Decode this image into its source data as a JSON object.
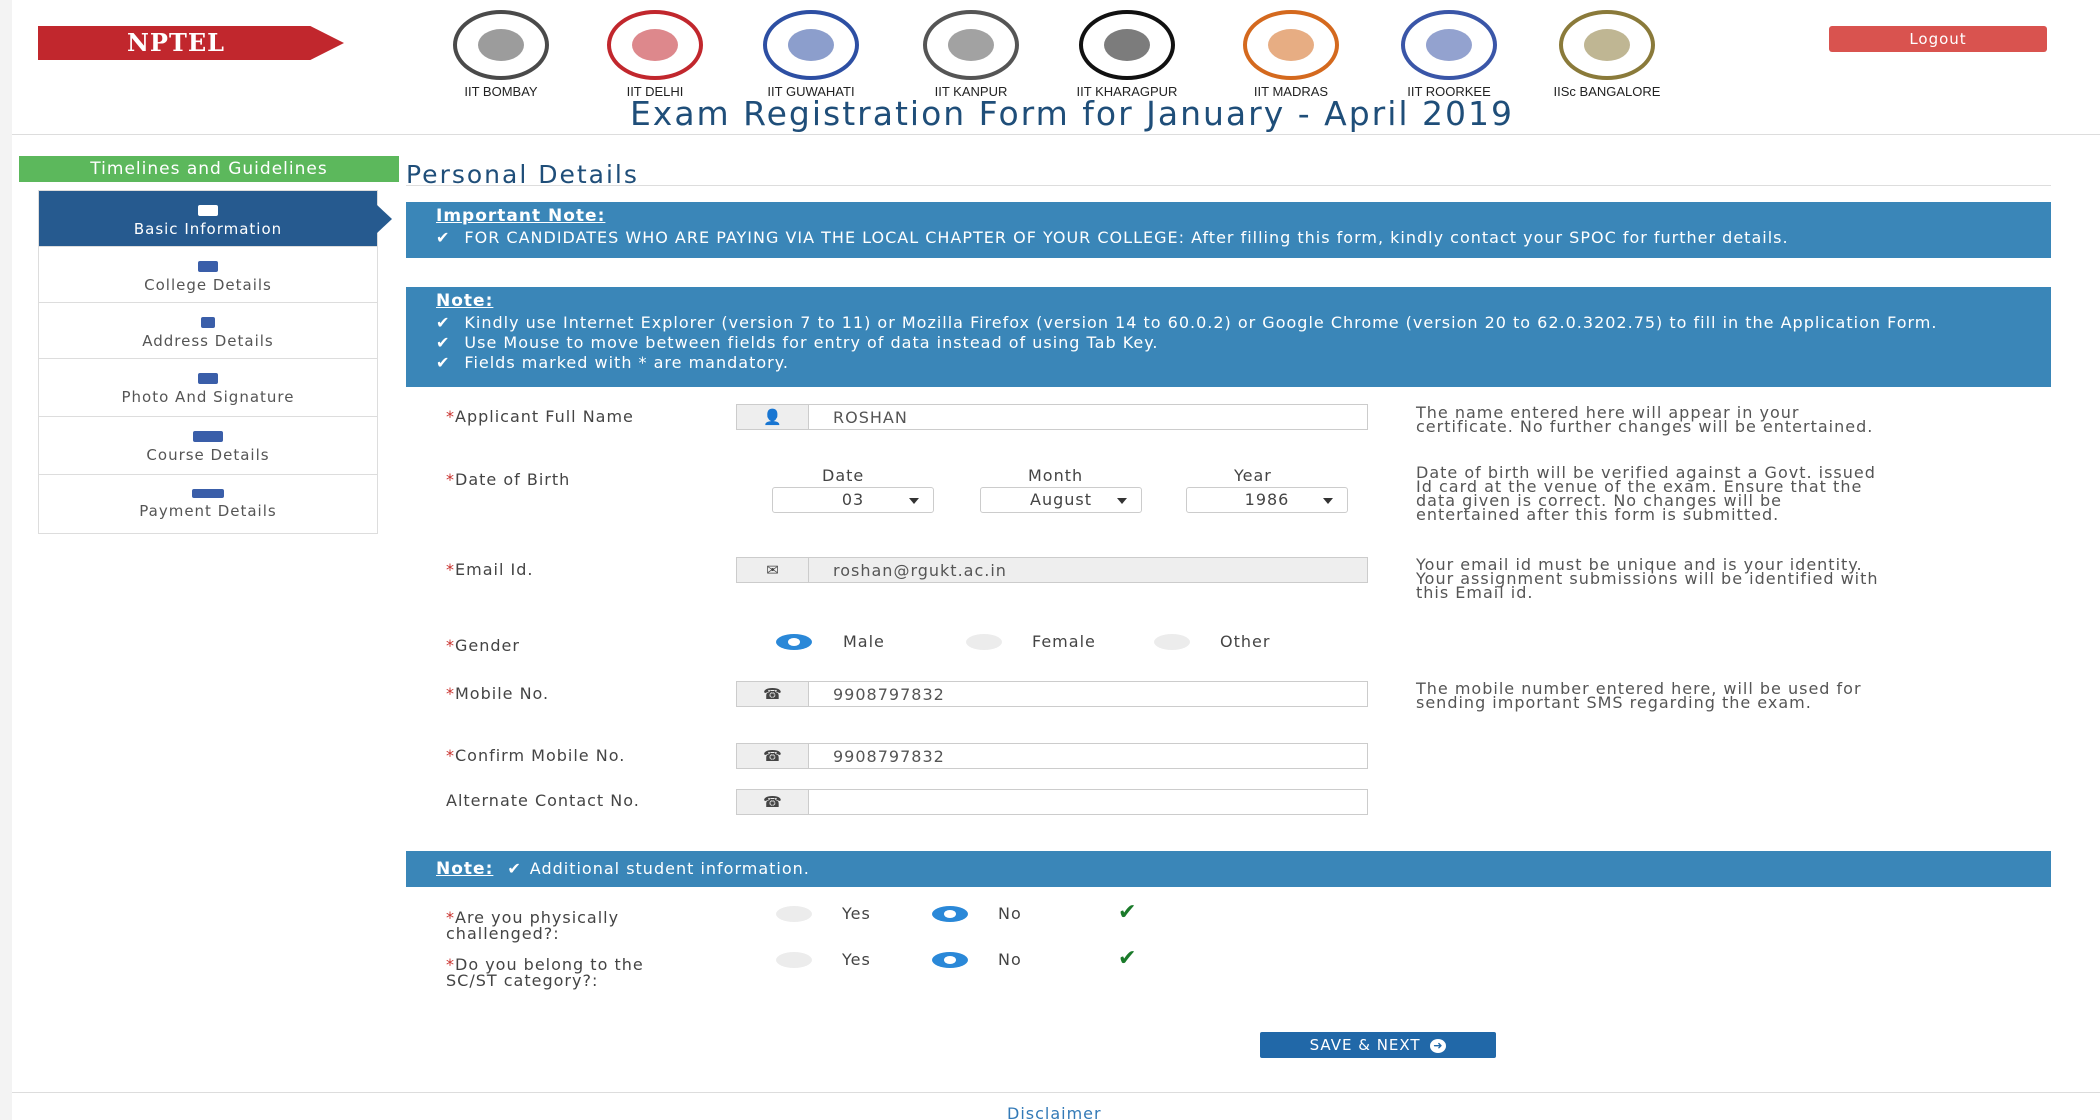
{
  "header": {
    "brand": "NPTEL",
    "logout_label": "Logout",
    "page_title": "Exam Registration Form for January - April 2019",
    "institutes": [
      {
        "name": "IIT BOMBAY",
        "color": "#4a4a4a"
      },
      {
        "name": "IIT DELHI",
        "color": "#c1272d"
      },
      {
        "name": "IIT GUWAHATI",
        "color": "#2d4fa3"
      },
      {
        "name": "IIT KANPUR",
        "color": "#555555"
      },
      {
        "name": "IIT KHARAGPUR",
        "color": "#111111"
      },
      {
        "name": "IIT MADRAS",
        "color": "#d4691e"
      },
      {
        "name": "IIT ROORKEE",
        "color": "#3a56a8"
      },
      {
        "name": "IISc BANGALORE",
        "color": "#8a7a3a"
      }
    ]
  },
  "sidebar": {
    "timelines_label": "Timelines and Guidelines",
    "items": [
      {
        "label": "Basic Information",
        "active": true
      },
      {
        "label": "College Details",
        "active": false
      },
      {
        "label": "Address Details",
        "active": false
      },
      {
        "label": "Photo And Signature",
        "active": false
      },
      {
        "label": "Course Details",
        "active": false
      },
      {
        "label": "Payment Details",
        "active": false
      }
    ]
  },
  "main": {
    "section_title": "Personal Details",
    "important_note": {
      "title": "Important Note:",
      "lines": [
        "FOR CANDIDATES WHO ARE PAYING VIA THE LOCAL CHAPTER OF YOUR COLLEGE: After filling this form, kindly contact your SPOC for further details."
      ]
    },
    "note": {
      "title": "Note:",
      "lines": [
        "Kindly use Internet Explorer (version 7 to 11) or Mozilla Firefox (version 14 to 60.0.2) or Google Chrome (version 20 to 62.0.3202.75) to fill in the Application Form.",
        "Use Mouse to move between fields for entry of data instead of using Tab Key.",
        "Fields marked with * are mandatory."
      ]
    },
    "full_name": {
      "label": "Applicant Full Name",
      "value": "ROSHAN",
      "help": "The name entered here will appear in your certificate. No further changes will be entertained."
    },
    "dob": {
      "label": "Date of Birth",
      "date_head": "Date",
      "month_head": "Month",
      "year_head": "Year",
      "date": "03",
      "month": "August",
      "year": "1986",
      "help": "Date of birth will be verified against a Govt. issued Id card at the venue of the exam. Ensure that the data given is correct. No changes will be entertained after this form is submitted."
    },
    "email": {
      "label": "Email Id.",
      "value": "roshan@rgukt.ac.in",
      "help": "Your email id must be unique and is your identity. Your assignment submissions will be identified with this Email id."
    },
    "gender": {
      "label": "Gender",
      "options": [
        "Male",
        "Female",
        "Other"
      ],
      "selected": "Male"
    },
    "mobile": {
      "label": "Mobile No.",
      "value": "9908797832",
      "help": "The mobile number entered here, will be used for sending important SMS regarding the exam."
    },
    "confirm_mobile": {
      "label": "Confirm Mobile No.",
      "value": "9908797832"
    },
    "alt_contact": {
      "label": "Alternate Contact No.",
      "value": ""
    },
    "additional_note": {
      "title": "Note:",
      "text": "Additional student information."
    },
    "physically_challenged": {
      "label": "Are you physically challenged?:",
      "yes": "Yes",
      "no": "No",
      "selected": "No"
    },
    "scst": {
      "label": "Do you belong to the SC/ST category?:",
      "yes": "Yes",
      "no": "No",
      "selected": "No"
    },
    "save_label": "SAVE & NEXT",
    "disclaimer": "Disclaimer"
  }
}
